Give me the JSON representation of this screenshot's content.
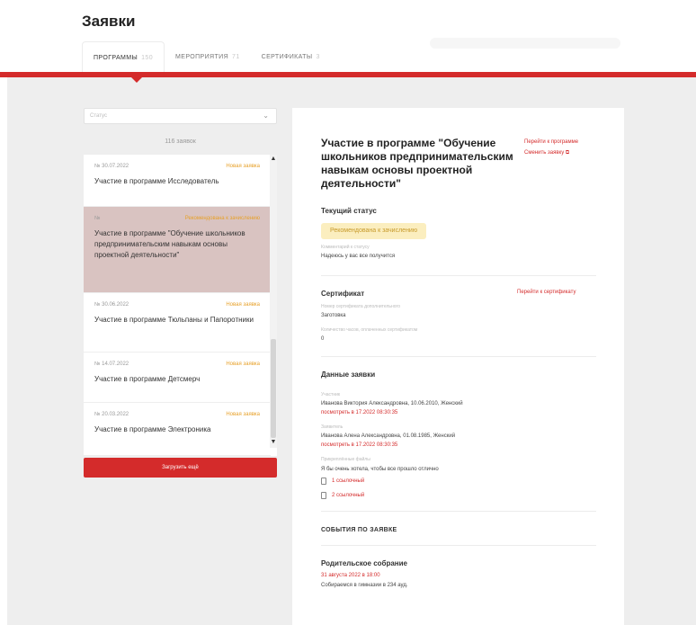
{
  "header": {
    "title": "Заявки",
    "tabs": [
      {
        "label": "ПРОГРАММЫ",
        "count": "150"
      },
      {
        "label": "МЕРОПРИЯТИЯ",
        "count": "71"
      },
      {
        "label": "СЕРТИФИКАТЫ",
        "count": "3"
      }
    ]
  },
  "left": {
    "filter_placeholder": "Статус",
    "count_label": "116 заявок",
    "items": [
      {
        "num": "№",
        "date": "30.07.2022",
        "status": "Новая заявка",
        "title": "Участие в программе Исследователь"
      },
      {
        "num": "№",
        "date": "",
        "status": "Рекомендована к зачислению",
        "title": "Участие в программе \"Обучение школьников предпринимательским навыкам основы проектной деятельности\""
      },
      {
        "num": "№",
        "date": "30.06.2022",
        "status": "Новая заявка",
        "title": "Участие в программе Тюльпаны и Папоротники"
      },
      {
        "num": "№",
        "date": "14.07.2022",
        "status": "Новая заявка",
        "title": "Участие в программе Детсмерч"
      },
      {
        "num": "№",
        "date": "20.03.2022",
        "status": "Новая заявка",
        "title": "Участие в программе Электроника"
      }
    ],
    "upload_label": "Загрузить ещё"
  },
  "detail": {
    "title": "Участие в программе \"Обучение школьников предпринимательским навыкам основы проектной деятельности\"",
    "link_program": "Перейти к программе",
    "link_change": "Сменить заявку",
    "status_section": "Текущий статус",
    "status_badge": "Рекомендована к зачислению",
    "status_sub_label": "Комментарий к статусу",
    "status_sub_value": "Надеюсь у вас все получится",
    "cert_section": "Сертификат",
    "cert_link": "Перейти к сертификату",
    "cert_label1": "Номер сертификата дополнительного",
    "cert_value1": "Заготовка",
    "cert_label2": "Количество часов, оплаченных сертификатом",
    "cert_value2": "0",
    "app_section": "Данные заявки",
    "app_label1": "Участник",
    "app_value1": "Иванова Виктория Александровна, 10.06.2010, Женский",
    "app_link1": "посмотреть в 17.2022 08:30:35",
    "app_label2": "Заявитель",
    "app_value2": "Иванова Алена Александровна, 01.08.1985, Женский",
    "app_link2": "посмотреть в 17.2022 08:30:35",
    "app_label3": "Прикреплённые файлы",
    "app_value3": "Я бы очень хотела, чтобы все прошло отлично",
    "file1": "1 ссылочный",
    "file2": "2 ссылочный",
    "events_section": "СОБЫТИЯ ПО ЗАЯВКЕ",
    "event_title": "Родительское собрание",
    "event_date": "31 августа 2022 в 18:00",
    "event_desc": "Собираемся в гимназии в 234 ауд."
  },
  "colors": {
    "accent": "#d42b2b",
    "status_badge_bg": "#fbeebf",
    "status_orange": "#e7a12a",
    "selected_item": "#d9c3c1",
    "page_bg": "#eeeeee"
  }
}
